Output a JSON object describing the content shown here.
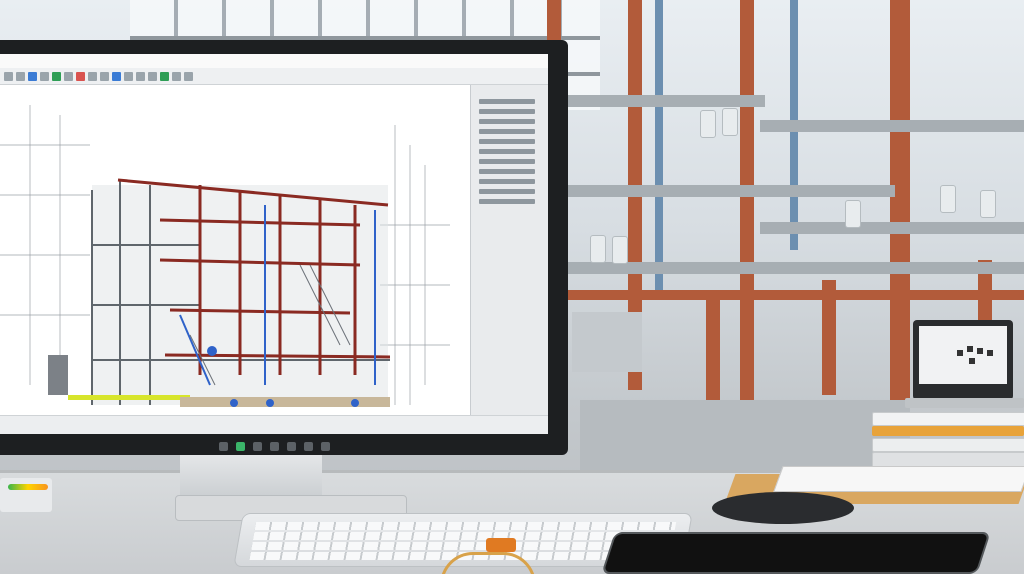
{
  "scene": {
    "description_colors": {
      "steel_beam": "#b25b3a",
      "screen_background": "#f4f5f6",
      "monitor_bezel": "#1d1f21",
      "desk": "#d9dcde"
    }
  },
  "cad_app": {
    "menu_items": [
      "",
      "",
      "",
      "",
      "",
      ""
    ],
    "model_frame_color": "#8a2a22",
    "model_accent_color": "#2f62c9",
    "highlight_color": "#d7e52b"
  },
  "taskbar": {
    "icons": [
      "start-icon",
      "search-icon",
      "files-icon",
      "app-icon",
      "app-icon",
      "app-icon",
      "app-icon"
    ]
  }
}
